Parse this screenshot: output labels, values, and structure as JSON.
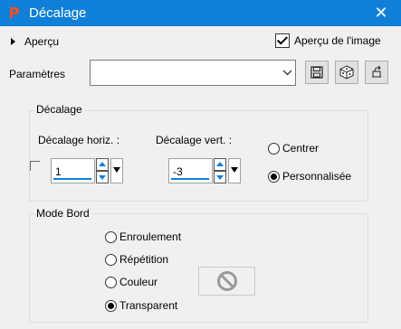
{
  "window": {
    "title": "Décalage",
    "close_glyph": "✕"
  },
  "apercu": {
    "label": "Aperçu",
    "image_preview_label": "Aperçu de l'image",
    "image_preview_checked": true
  },
  "params": {
    "label": "Paramètres",
    "value": ""
  },
  "toolbar": {
    "icons": [
      "save-icon",
      "random-dice-icon",
      "reset-icon"
    ]
  },
  "decalage": {
    "title": "Décalage",
    "horiz_label": "Décalage horiz. :",
    "horiz_value": "1",
    "vert_label": "Décalage vert. :",
    "vert_value": "-3",
    "centrer": "Centrer",
    "personnalisee": "Personnalisée",
    "selected": "personnalisee"
  },
  "mode_bord": {
    "title": "Mode Bord",
    "options": [
      "Enroulement",
      "Répétition",
      "Couleur",
      "Transparent"
    ],
    "selected": "Transparent"
  },
  "colors": {
    "titlebar": "#0f7fd7",
    "accent": "#0f7fd7"
  }
}
